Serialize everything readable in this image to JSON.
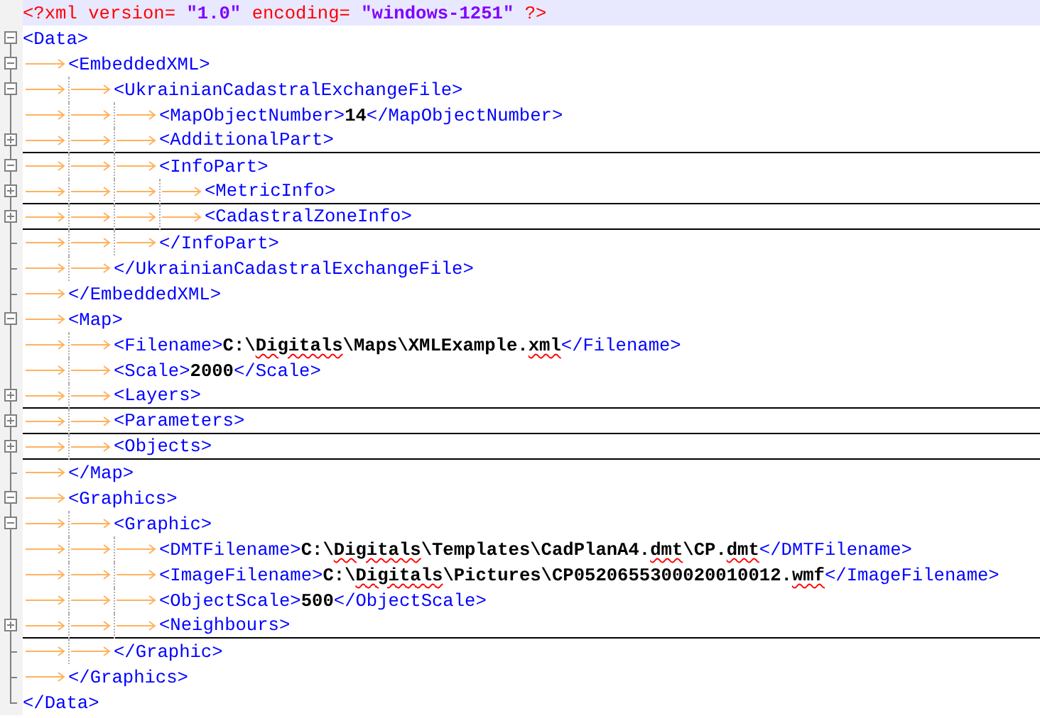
{
  "declaration": [
    {
      "kind": "punct",
      "text": "<?xml"
    },
    {
      "kind": "attr",
      "text": "version="
    },
    {
      "kind": "string",
      "text": "\"1.0\""
    },
    {
      "kind": "attr",
      "text": "encoding="
    },
    {
      "kind": "string",
      "text": "\"windows-1251\""
    },
    {
      "kind": "punct",
      "text": "?>"
    }
  ],
  "document": {
    "kind": "branch",
    "open": "<Data>",
    "collapsed": false,
    "close": "</Data>",
    "children": [
      {
        "kind": "branch",
        "open": "<EmbeddedXML>",
        "collapsed": false,
        "close": "</EmbeddedXML>",
        "children": [
          {
            "kind": "branch",
            "open": "<UkrainianCadastralExchangeFile>",
            "collapsed": false,
            "close": "</UkrainianCadastralExchangeFile>",
            "children": [
              {
                "kind": "leaf",
                "open": "<MapObjectNumber>",
                "value": [
                  {
                    "text": "14",
                    "misspelled": false
                  }
                ],
                "close": "</MapObjectNumber>"
              },
              {
                "kind": "branch",
                "open": "<AdditionalPart>",
                "collapsed": true
              },
              {
                "kind": "branch",
                "open": "<InfoPart>",
                "collapsed": false,
                "close": "</InfoPart>",
                "children": [
                  {
                    "kind": "branch",
                    "open": "<MetricInfo>",
                    "collapsed": true
                  },
                  {
                    "kind": "branch",
                    "open": "<CadastralZoneInfo>",
                    "collapsed": true
                  }
                ]
              }
            ]
          }
        ]
      },
      {
        "kind": "branch",
        "open": "<Map>",
        "collapsed": false,
        "close": "</Map>",
        "children": [
          {
            "kind": "leaf",
            "open": "<Filename>",
            "value": [
              {
                "text": "C:\\",
                "misspelled": false
              },
              {
                "text": "Digitals",
                "misspelled": true
              },
              {
                "text": "\\Maps\\XMLExample.",
                "misspelled": false
              },
              {
                "text": "xml",
                "misspelled": true
              }
            ],
            "close": "</Filename>"
          },
          {
            "kind": "leaf",
            "open": "<Scale>",
            "value": [
              {
                "text": "2000",
                "misspelled": false
              }
            ],
            "close": "</Scale>"
          },
          {
            "kind": "branch",
            "open": "<Layers>",
            "collapsed": true
          },
          {
            "kind": "branch",
            "open": "<Parameters>",
            "collapsed": true
          },
          {
            "kind": "branch",
            "open": "<Objects>",
            "collapsed": true
          }
        ]
      },
      {
        "kind": "branch",
        "open": "<Graphics>",
        "collapsed": false,
        "close": "</Graphics>",
        "children": [
          {
            "kind": "branch",
            "open": "<Graphic>",
            "collapsed": false,
            "close": "</Graphic>",
            "children": [
              {
                "kind": "leaf",
                "open": "<DMTFilename>",
                "value": [
                  {
                    "text": "C:\\",
                    "misspelled": false
                  },
                  {
                    "text": "Digitals",
                    "misspelled": true
                  },
                  {
                    "text": "\\Templates\\CadPlanA4.",
                    "misspelled": false
                  },
                  {
                    "text": "dmt",
                    "misspelled": true
                  },
                  {
                    "text": "\\CP.",
                    "misspelled": false
                  },
                  {
                    "text": "dmt",
                    "misspelled": true
                  }
                ],
                "close": "</DMTFilename>"
              },
              {
                "kind": "leaf",
                "open": "<ImageFilename>",
                "value": [
                  {
                    "text": "C:\\",
                    "misspelled": false
                  },
                  {
                    "text": "Digitals",
                    "misspelled": true
                  },
                  {
                    "text": "\\Pictures\\CP0520655300020010012.",
                    "misspelled": false
                  },
                  {
                    "text": "wmf",
                    "misspelled": true
                  }
                ],
                "close": "</ImageFilename>"
              },
              {
                "kind": "leaf",
                "open": "<ObjectScale>",
                "value": [
                  {
                    "text": "500",
                    "misspelled": false
                  }
                ],
                "close": "</ObjectScale>"
              },
              {
                "kind": "branch",
                "open": "<Neighbours>",
                "collapsed": true
              }
            ]
          }
        ]
      }
    ]
  }
}
